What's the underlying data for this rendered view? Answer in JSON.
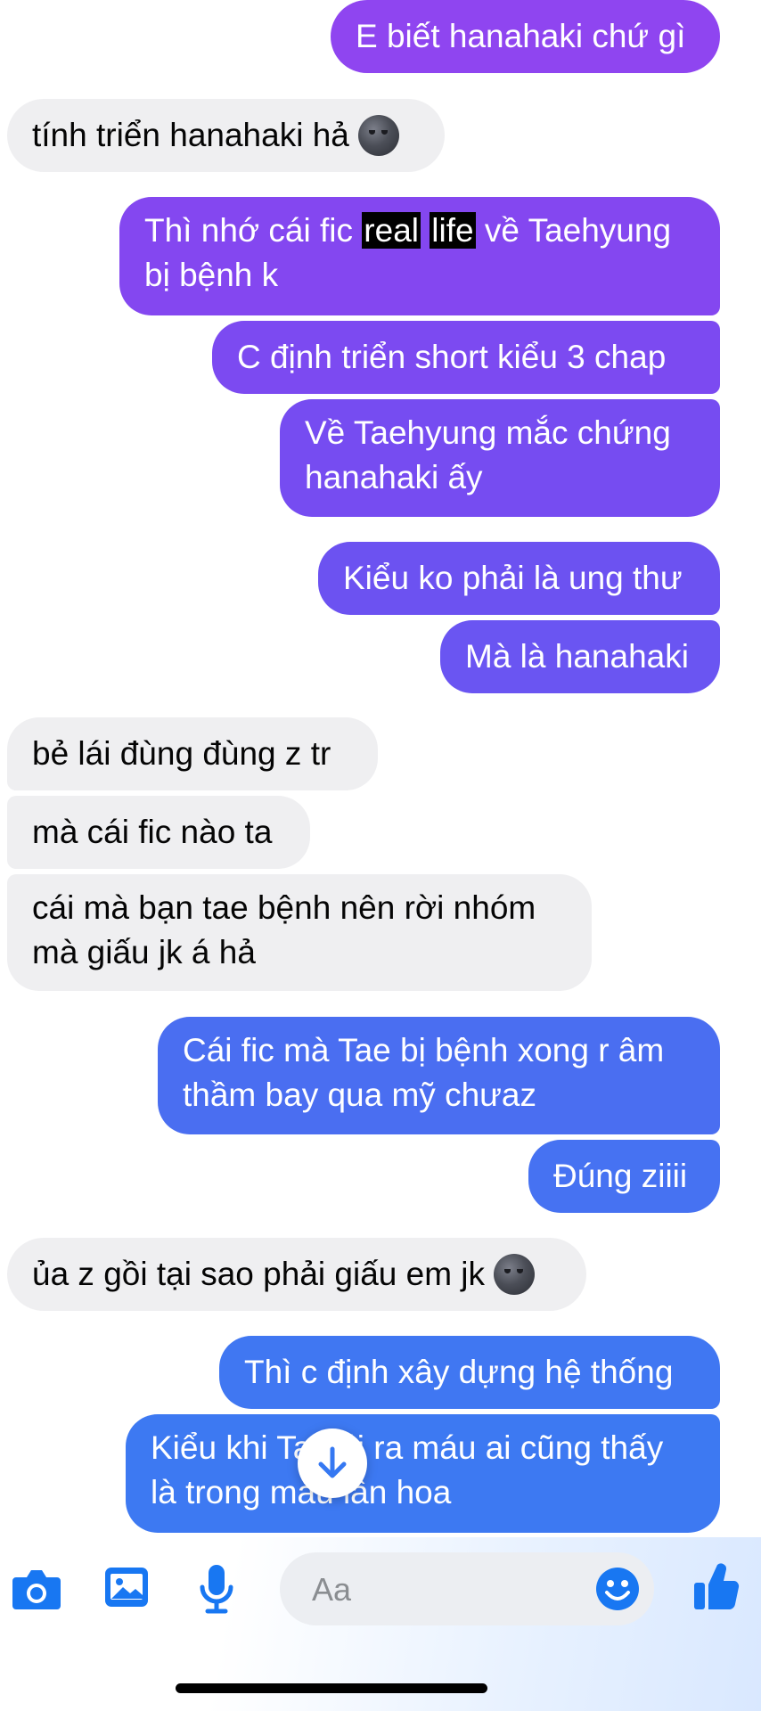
{
  "messages": {
    "m1": "E biết hanahaki chứ gì",
    "m2": "tính triển hanahaki hả",
    "m3_a": "Thì nhớ cái fic ",
    "m3_hl1": "real",
    "m3_hl2": "life",
    "m3_b": " về Taehyung bị bệnh k",
    "m4": "C định triển short kiểu 3 chap",
    "m5": "Về Taehyung mắc chứng hanahaki ấy",
    "m6": "Kiểu ko phải là ung thư",
    "m7": "Mà là hanahaki",
    "m8": "bẻ lái đùng đùng z tr",
    "m9": "mà cái fic nào ta",
    "m10": "cái mà bạn tae bệnh nên rời nhóm mà giấu jk á hả",
    "m11": "Cái fic mà Tae bị bệnh xong r âm thầm bay qua mỹ chưaz",
    "m12": "Đúng ziiii",
    "m13": "ủa z gồi tại sao phải giấu em jk",
    "m14": "Thì c định xây dựng hệ thống",
    "m15": "Kiểu khi Tae ói ra máu ai cũng thấy là trong máu lẫn hoa"
  },
  "emoji": {
    "m2": "new-moon-face",
    "m13": "new-moon-face"
  },
  "composer": {
    "placeholder": "Aa",
    "icons": [
      "camera-icon",
      "image-icon",
      "microphone-icon",
      "emoji-icon",
      "like-icon"
    ]
  },
  "colors": {
    "incoming": "#efeff1",
    "outgoing_top": "#8f45f0",
    "outgoing_mid": "#6d55f2",
    "outgoing_bottom": "#3f79f2",
    "accent": "#1877f2"
  }
}
